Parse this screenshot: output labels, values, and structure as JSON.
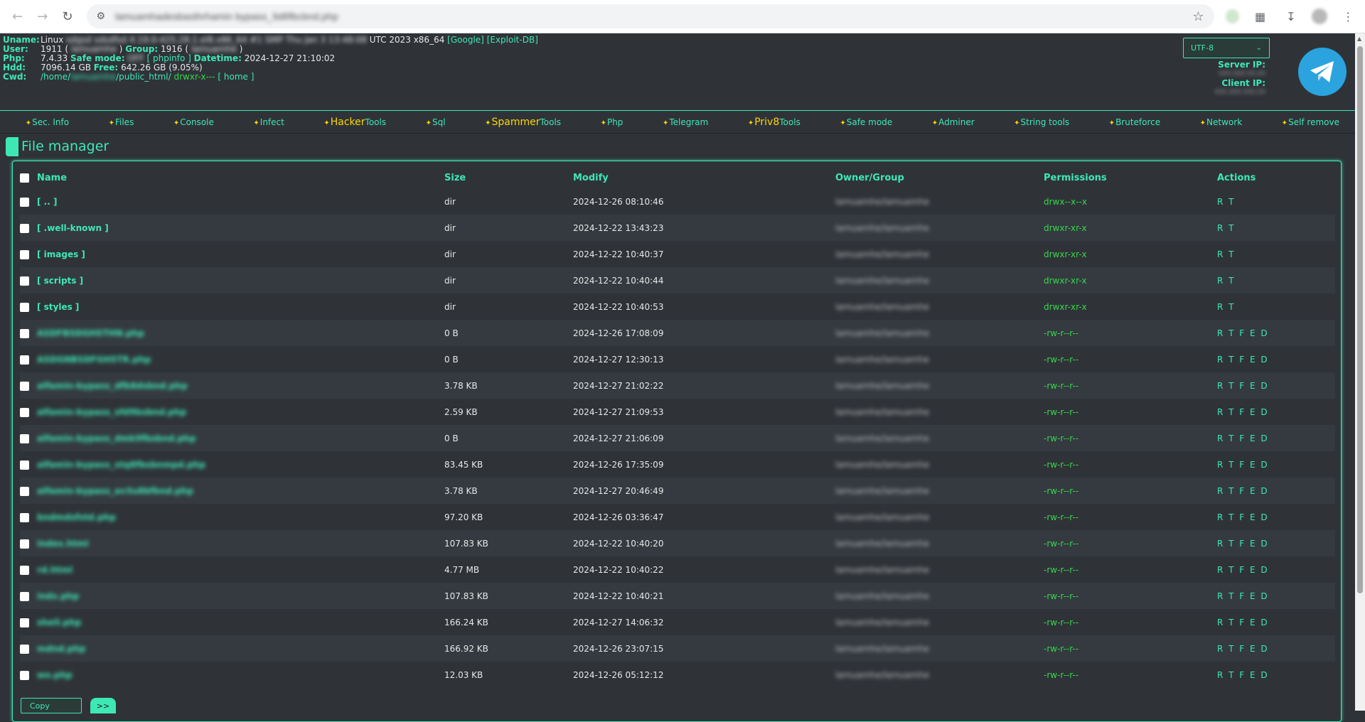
{
  "browser": {
    "url": "lamuamhadesbasthrhamin bypass_9d8fbcbnd.php",
    "back_icon": "arrow-left-icon",
    "forward_icon": "arrow-right-icon",
    "reload_icon": "reload-icon"
  },
  "info": {
    "uname_label": "Uname:",
    "uname_os": "Linux",
    "uname_blur": "sdgsd sdsdfsd 4.19.0-425.28.1.el8.x86_64 #1 SMP Thu Jan 3 13:48:08",
    "uname_tail": "UTC 2023 x86_64",
    "google_link": "[Google]",
    "exploitdb_link": "[Exploit-DB]",
    "user_label": "User:",
    "user_id": "1911 (",
    "user_name": "lamuamhe",
    "user_close": ")",
    "group_label": "Group:",
    "group_id": "1916 (",
    "group_name": "lamuamhe",
    "group_close": ")",
    "php_label": "Php:",
    "php_version": "7.4.33",
    "safemode_label": "Safe mode:",
    "safemode_value": "OFF",
    "phpinfo_link": "[ phpinfo ]",
    "datetime_label": "Datetime:",
    "datetime_value": "2024-12-27 21:10:02",
    "hdd_label": "Hdd:",
    "hdd_total": "7096.14 GB",
    "free_label": "Free:",
    "hdd_free": "642.26 GB (9.05%)",
    "cwd_label": "Cwd:",
    "cwd_prefix": "/home/",
    "cwd_user": "lamuamhe",
    "cwd_suffix": "/public_html/",
    "cwd_perm": "drwxr-x---",
    "home_link": "[ home ]"
  },
  "charset": {
    "value": "UTF-8"
  },
  "ip": {
    "server_label": "Server IP:",
    "server_value": "000.000.00.00",
    "client_label": "Client IP:",
    "client_value": "000.000.000.00"
  },
  "menu": [
    {
      "label": "Sec. Info"
    },
    {
      "label": "Files"
    },
    {
      "label": "Console"
    },
    {
      "label": "Infect"
    },
    {
      "big": "Hacker",
      "label": "Tools"
    },
    {
      "label": "Sql"
    },
    {
      "big": "Spammer",
      "label": "Tools"
    },
    {
      "label": "Php"
    },
    {
      "label": "Telegram"
    },
    {
      "big": "Priv8",
      "label": "Tools"
    },
    {
      "label": "Safe mode"
    },
    {
      "label": "Adminer"
    },
    {
      "label": "String tools"
    },
    {
      "label": "Bruteforce"
    },
    {
      "label": "Network"
    },
    {
      "label": "Self remove"
    }
  ],
  "file_manager": {
    "title": "File manager",
    "columns": [
      "Name",
      "Size",
      "Modify",
      "Owner/Group",
      "Permissions",
      "Actions"
    ],
    "rows": [
      {
        "name": "[ .. ]",
        "size": "dir",
        "modify": "2024-12-26 08:10:46",
        "owner": "lamuamhe/lamuamhe",
        "perm": "drwx--x--x",
        "actions": "R T",
        "dir": true
      },
      {
        "name": "[ .well-known ]",
        "size": "dir",
        "modify": "2024-12-22 13:43:23",
        "owner": "lamuamhe/lamuamhe",
        "perm": "drwxr-xr-x",
        "actions": "R T",
        "dir": true
      },
      {
        "name": "[ images ]",
        "size": "dir",
        "modify": "2024-12-22 10:40:37",
        "owner": "lamuamhe/lamuamhe",
        "perm": "drwxr-xr-x",
        "actions": "R T",
        "dir": true
      },
      {
        "name": "[ scripts ]",
        "size": "dir",
        "modify": "2024-12-22 10:40:44",
        "owner": "lamuamhe/lamuamhe",
        "perm": "drwxr-xr-x",
        "actions": "R T",
        "dir": true
      },
      {
        "name": "[ styles ]",
        "size": "dir",
        "modify": "2024-12-22 10:40:53",
        "owner": "lamuamhe/lamuamhe",
        "perm": "drwxr-xr-x",
        "actions": "R T",
        "dir": true
      },
      {
        "name": "ASDFBSDGHSTHN.php",
        "size": "0 B",
        "modify": "2024-12-26 17:08:09",
        "owner": "lamuamhe/lamuamhe",
        "perm": "-rw-r--r--",
        "actions": "R T F E D",
        "dir": false
      },
      {
        "name": "ASDGNBSDFGHSTR.php",
        "size": "0 B",
        "modify": "2024-12-27 12:30:13",
        "owner": "lamuamhe/lamuamhe",
        "perm": "-rw-r--r--",
        "actions": "R T F E D",
        "dir": false
      },
      {
        "name": "alfamin-bypass_dfb8dsbnd.php",
        "size": "3.78 KB",
        "modify": "2024-12-27 21:02:22",
        "owner": "lamuamhe/lamuamhe",
        "perm": "-rw-r--r--",
        "actions": "R T F E D",
        "dir": false
      },
      {
        "name": "alfamin-bypass_sfd9bsbnd.php",
        "size": "2.59 KB",
        "modify": "2024-12-27 21:09:53",
        "owner": "lamuamhe/lamuamhe",
        "perm": "-rw-r--r--",
        "actions": "R T F E D",
        "dir": false
      },
      {
        "name": "alfamin-bypass_dmk9fbsbnd.php",
        "size": "0 B",
        "modify": "2024-12-27 21:06:09",
        "owner": "lamuamhe/lamuamhe",
        "perm": "-rw-r--r--",
        "actions": "R T F E D",
        "dir": false
      },
      {
        "name": "alfamin-bypass_stq8fbsbnmpd.php",
        "size": "83.45 KB",
        "modify": "2024-12-26 17:35:09",
        "owner": "lamuamhe/lamuamhe",
        "perm": "-rw-r--r--",
        "actions": "R T F E D",
        "dir": false
      },
      {
        "name": "alfamin-bypass_av3u8bfbnd.php",
        "size": "3.78 KB",
        "modify": "2024-12-27 20:46:49",
        "owner": "lamuamhe/lamuamhe",
        "perm": "-rw-r--r--",
        "actions": "R T F E D",
        "dir": false
      },
      {
        "name": "bndmdsfstd.php",
        "size": "97.20 KB",
        "modify": "2024-12-26 03:36:47",
        "owner": "lamuamhe/lamuamhe",
        "perm": "-rw-r--r--",
        "actions": "R T F E D",
        "dir": false
      },
      {
        "name": "index.html",
        "size": "107.83 KB",
        "modify": "2024-12-22 10:40:20",
        "owner": "lamuamhe/lamuamhe",
        "perm": "-rw-r--r--",
        "actions": "R T F E D",
        "dir": false
      },
      {
        "name": "rd.html",
        "size": "4.77 MB",
        "modify": "2024-12-22 10:40:22",
        "owner": "lamuamhe/lamuamhe",
        "perm": "-rw-r--r--",
        "actions": "R T F E D",
        "dir": false
      },
      {
        "name": "indx.php",
        "size": "107.83 KB",
        "modify": "2024-12-22 10:40:21",
        "owner": "lamuamhe/lamuamhe",
        "perm": "-rw-r--r--",
        "actions": "R T F E D",
        "dir": false
      },
      {
        "name": "shell.php",
        "size": "166.24 KB",
        "modify": "2024-12-27 14:06:32",
        "owner": "lamuamhe/lamuamhe",
        "perm": "-rw-r--r--",
        "actions": "R T F E D",
        "dir": false
      },
      {
        "name": "mdnd.php",
        "size": "166.92 KB",
        "modify": "2024-12-26 23:07:15",
        "owner": "lamuamhe/lamuamhe",
        "perm": "-rw-r--r--",
        "actions": "R T F E D",
        "dir": false
      },
      {
        "name": "wo.php",
        "size": "12.03 KB",
        "modify": "2024-12-26 05:12:12",
        "owner": "lamuamhe/lamuamhe",
        "perm": "-rw-r--r--",
        "actions": "R T F E D",
        "dir": false
      }
    ],
    "bulk_action": "Copy",
    "go_label": ">>"
  },
  "colors": {
    "accent": "#3ee8b5",
    "gold": "#ffd700",
    "perm": "#36d84b",
    "bg": "#2f3338",
    "telegram": "#2aa3de"
  }
}
